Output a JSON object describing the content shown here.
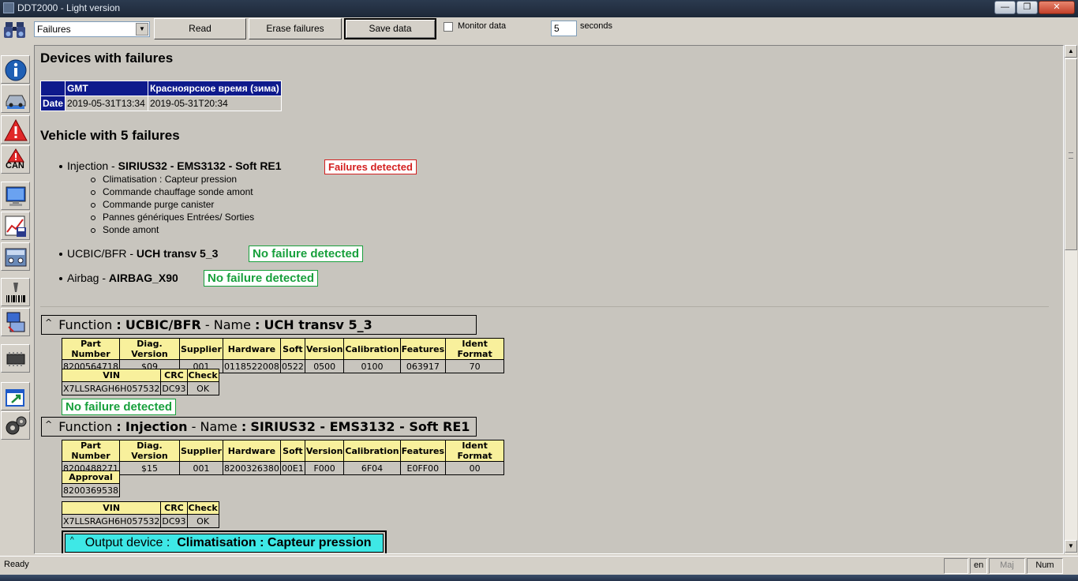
{
  "window": {
    "title": "DDT2000 - Light version",
    "min": "—",
    "max": "❐",
    "close": "✕"
  },
  "toolbar": {
    "view_select": "Failures",
    "read_label": "Read",
    "erase_label": "Erase failures",
    "save_label": "Save data",
    "monitor_label": "Monitor data",
    "interval_value": "5",
    "seconds_label": "seconds"
  },
  "sidebar": {
    "icons": [
      "binoculars-icon",
      "info-icon",
      "vehicle-icon",
      "warning-icon",
      "can-warning-icon",
      "monitor-icon",
      "chart-save-icon",
      "control-panel-icon",
      "barcode-scanner-icon",
      "ecu-programming-icon",
      "chip-icon",
      "export-window-icon",
      "gears-icon"
    ],
    "can_label": "CAN"
  },
  "report": {
    "title": "Devices with failures",
    "time_table": {
      "headers": [
        "",
        "GMT",
        "Красноярское время (зима)"
      ],
      "row_label": "Date",
      "gmt": "2019-05-31T13:34",
      "local": "2019-05-31T20:34"
    },
    "vehicle_title": "Vehicle with 5 failures",
    "ecus": [
      {
        "function": "Injection",
        "sep": " - ",
        "name": "SIRIUS32 - EMS3132 - Soft RE1",
        "status": "Failures detected",
        "failures": [
          "Climatisation : Capteur pression",
          "Commande chauffage sonde amont",
          "Commande purge canister",
          "Pannes génériques Entrées/ Sorties",
          "Sonde amont"
        ]
      },
      {
        "function": "UCBIC/BFR",
        "sep": " - ",
        "name": "UCH transv 5_3",
        "status": "No failure detected"
      },
      {
        "function": "Airbag",
        "sep": " - ",
        "name": "AIRBAG_X90",
        "status": "No failure detected"
      }
    ]
  },
  "blocks": [
    {
      "caret": "^",
      "function_label": "Function",
      "colon": ":",
      "function": "UCBIC/BFR",
      "name_label": "- Name",
      "name": "UCH transv 5_3",
      "ident": {
        "headers": [
          "Part Number",
          "Diag. Version",
          "Supplier",
          "Hardware",
          "Soft",
          "Version",
          "Calibration",
          "Features",
          "Ident Format"
        ],
        "values": [
          "8200564718",
          "$09",
          "001",
          "0118522008",
          "0522",
          "0500",
          "0100",
          "063917",
          "70"
        ]
      },
      "vin": {
        "headers": [
          "VIN",
          "CRC",
          "Check"
        ],
        "values": [
          "X7LLSRAGH6H057532",
          "DC93",
          "OK"
        ]
      },
      "status": "No failure detected"
    },
    {
      "caret": "^",
      "function_label": "Function",
      "colon": ":",
      "function": "Injection",
      "name_label": "- Name",
      "name": "SIRIUS32 - EMS3132 - Soft RE1",
      "ident": {
        "headers": [
          "Part Number",
          "Diag. Version",
          "Supplier",
          "Hardware",
          "Soft",
          "Version",
          "Calibration",
          "Features",
          "Ident Format"
        ],
        "values": [
          "8200488271",
          "$15",
          "001",
          "8200326380",
          "00E1",
          "F000",
          "6F04",
          "E0FF00",
          "00"
        ]
      },
      "approval": {
        "header": "Approval",
        "value": "8200369538"
      },
      "vin": {
        "headers": [
          "VIN",
          "CRC",
          "Check"
        ],
        "values": [
          "X7LLSRAGH6H057532",
          "DC93",
          "OK"
        ]
      },
      "output_device": {
        "caret": "^",
        "label": "Output device :",
        "value": "Climatisation : Capteur pression"
      }
    }
  ],
  "statusbar": {
    "text": "Ready",
    "lang": "en",
    "caps": "Maj",
    "num": "Num"
  },
  "colors": {
    "header_blue": "#0e1a8c",
    "table_header_yellow": "#f8f09c",
    "fail_red": "#d42020",
    "ok_green": "#18a03c",
    "output_cyan": "#3ee8e6"
  }
}
